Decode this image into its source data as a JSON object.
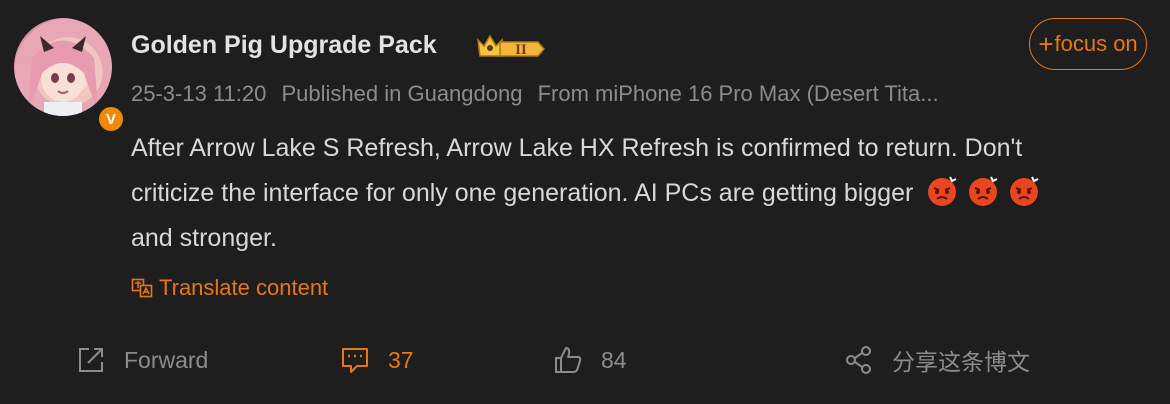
{
  "post": {
    "author": "Golden Pig Upgrade Pack",
    "rank_badge": "II",
    "date": "25-3-13 11:20",
    "location": "Published in Guangdong",
    "source": "From miPhone 16 Pro Max (Desert Tita...",
    "focus_label": "focus on",
    "text_line1": "After Arrow Lake S Refresh, Arrow Lake HX Refresh is confirmed to return. Don't",
    "text_line2": "criticize the interface for only one generation. AI PCs are getting bigger",
    "text_line3": "and stronger.",
    "emojis": [
      "angry-face-emoji",
      "angry-face-emoji",
      "angry-face-emoji"
    ],
    "translate_label": "Translate content",
    "verified_badge": "V"
  },
  "actions": {
    "forward_label": "Forward",
    "comments_count": "37",
    "likes_count": "84",
    "share_label": "分享这条博文"
  },
  "colors": {
    "background": "#1e1e1e",
    "accent": "#e8770f",
    "muted": "#8c8c8c",
    "text": "#d8d8d8"
  }
}
